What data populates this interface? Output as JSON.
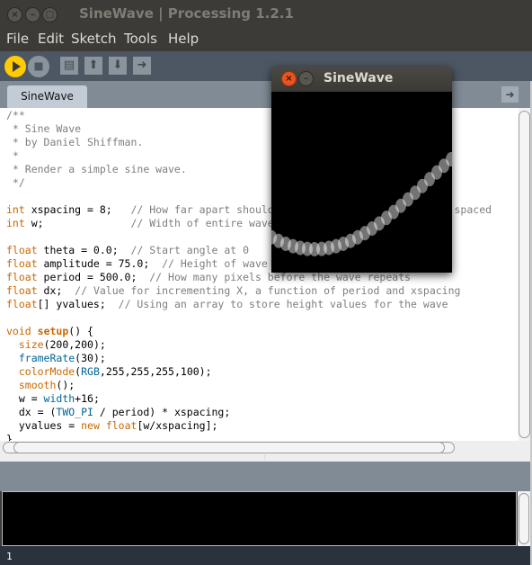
{
  "window": {
    "title": "SineWave | Processing 1.2.1"
  },
  "menu": [
    "File",
    "Edit",
    "Sketch",
    "Tools",
    "Help"
  ],
  "toolbar": {
    "run": "run-icon",
    "stop": "stop-icon",
    "new": "new-icon",
    "open": "open-icon",
    "save": "save-icon",
    "export": "export-icon"
  },
  "tab": {
    "label": "SineWave"
  },
  "colors": {
    "keyword": "#cc6600",
    "function": "#006699",
    "comment": "#7e7e7e",
    "run": "#ffcc00",
    "toolbar": "#4d5763"
  },
  "code": [
    [
      [
        "cm",
        "/**"
      ]
    ],
    [
      [
        "cm",
        " * Sine Wave"
      ]
    ],
    [
      [
        "cm",
        " * by Daniel Shiffman."
      ]
    ],
    [
      [
        "cm",
        " *"
      ]
    ],
    [
      [
        "cm",
        " * Render a simple sine wave."
      ]
    ],
    [
      [
        "cm",
        " */"
      ]
    ],
    [],
    [
      [
        "kw",
        "int"
      ],
      [
        "",
        " xspacing = 8;   "
      ],
      [
        "cm",
        "// How far apart should each horizontal location be spaced"
      ]
    ],
    [
      [
        "kw",
        "int"
      ],
      [
        "",
        " w;              "
      ],
      [
        "cm",
        "// Width of entire wave"
      ]
    ],
    [],
    [
      [
        "kw",
        "float"
      ],
      [
        "",
        " theta = 0.0;  "
      ],
      [
        "cm",
        "// Start angle at 0"
      ]
    ],
    [
      [
        "kw",
        "float"
      ],
      [
        "",
        " amplitude = 75.0;  "
      ],
      [
        "cm",
        "// Height of wave"
      ]
    ],
    [
      [
        "kw",
        "float"
      ],
      [
        "",
        " period = 500.0;  "
      ],
      [
        "cm",
        "// How many pixels before the wave repeats"
      ]
    ],
    [
      [
        "kw",
        "float"
      ],
      [
        "",
        " dx;  "
      ],
      [
        "cm",
        "// Value for incrementing X, a function of period and xspacing"
      ]
    ],
    [
      [
        "kw",
        "float"
      ],
      [
        "",
        "[] yvalues;  "
      ],
      [
        "cm",
        "// Using an array to store height values for the wave"
      ]
    ],
    [],
    [
      [
        "kw",
        "void"
      ],
      [
        "",
        " "
      ],
      [
        "kb",
        "setup"
      ],
      [
        "",
        "() {"
      ]
    ],
    [
      [
        "",
        "  "
      ],
      [
        "kw",
        "size"
      ],
      [
        "",
        "(200,200);"
      ]
    ],
    [
      [
        "",
        "  "
      ],
      [
        "fn",
        "frameRate"
      ],
      [
        "",
        "(30);"
      ]
    ],
    [
      [
        "",
        "  "
      ],
      [
        "kw",
        "colorMode"
      ],
      [
        "",
        "("
      ],
      [
        "fn",
        "RGB"
      ],
      [
        "",
        ",255,255,255,100);"
      ]
    ],
    [
      [
        "",
        "  "
      ],
      [
        "kw",
        "smooth"
      ],
      [
        "",
        "();"
      ]
    ],
    [
      [
        "",
        "  w = "
      ],
      [
        "fn",
        "width"
      ],
      [
        "",
        "+16;"
      ]
    ],
    [
      [
        "",
        "  dx = ("
      ],
      [
        "fn",
        "TWO_PI"
      ],
      [
        "",
        " / period) * xspacing;"
      ]
    ],
    [
      [
        "",
        "  yvalues = "
      ],
      [
        "kw",
        "new"
      ],
      [
        "",
        " "
      ],
      [
        "kw",
        "float"
      ],
      [
        "",
        "[w/xspacing];"
      ]
    ],
    [
      [
        "",
        "}"
      ]
    ]
  ],
  "sketch": {
    "title": "SineWave"
  },
  "status": {
    "line": "1"
  }
}
